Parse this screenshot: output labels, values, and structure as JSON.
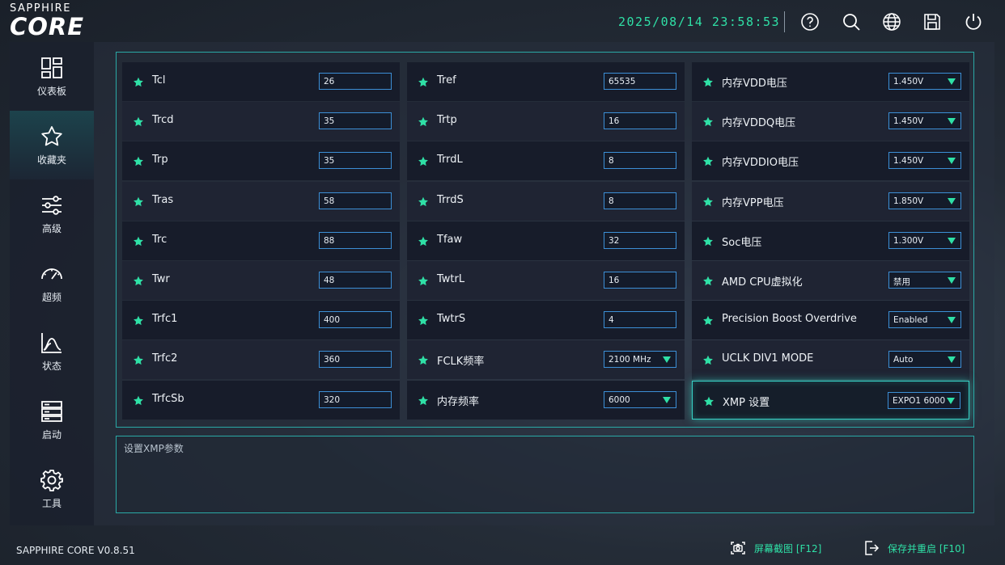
{
  "header": {
    "brand_small": "SAPPHIRE",
    "brand_big": "CORE",
    "datetime": "2025/08/14 23:58:53"
  },
  "sidebar": {
    "items": [
      {
        "label": "仪表板",
        "icon": "dashboard-icon"
      },
      {
        "label": "收藏夹",
        "icon": "star-icon"
      },
      {
        "label": "高级",
        "icon": "sliders-icon"
      },
      {
        "label": "超频",
        "icon": "gauge-icon"
      },
      {
        "label": "状态",
        "icon": "chart-icon"
      },
      {
        "label": "启动",
        "icon": "server-icon"
      },
      {
        "label": "工具",
        "icon": "gear-icon"
      }
    ],
    "active_index": 1
  },
  "settings": {
    "col1": [
      {
        "label": "Tcl",
        "value": "26"
      },
      {
        "label": "Trcd",
        "value": "35"
      },
      {
        "label": "Trp",
        "value": "35"
      },
      {
        "label": "Tras",
        "value": "58"
      },
      {
        "label": "Trc",
        "value": "88"
      },
      {
        "label": "Twr",
        "value": "48"
      },
      {
        "label": "Trfc1",
        "value": "400"
      },
      {
        "label": "Trfc2",
        "value": "360"
      },
      {
        "label": "TrfcSb",
        "value": "320"
      }
    ],
    "col2": [
      {
        "label": "Tref",
        "value": "65535"
      },
      {
        "label": "Trtp",
        "value": "16"
      },
      {
        "label": "TrrdL",
        "value": "8"
      },
      {
        "label": "TrrdS",
        "value": "8"
      },
      {
        "label": "Tfaw",
        "value": "32"
      },
      {
        "label": "TwtrL",
        "value": "16"
      },
      {
        "label": "TwtrS",
        "value": "4"
      },
      {
        "label": "FCLK频率",
        "value": "2100 MHz"
      },
      {
        "label": "内存频率",
        "value": "6000"
      }
    ],
    "col3": [
      {
        "label": "内存VDD电压",
        "value": "1.450V"
      },
      {
        "label": "内存VDDQ电压",
        "value": "1.450V"
      },
      {
        "label": "内存VDDIO电压",
        "value": "1.450V"
      },
      {
        "label": "内存VPP电压",
        "value": "1.850V"
      },
      {
        "label": "Soc电压",
        "value": "1.300V"
      },
      {
        "label": "AMD CPU虚拟化",
        "value": "禁用"
      },
      {
        "label": "Precision Boost Overdrive",
        "value": "Enabled"
      },
      {
        "label": "UCLK DIV1 MODE",
        "value": "Auto"
      },
      {
        "label": "XMP 设置",
        "value": "EXPO1 6000"
      }
    ]
  },
  "description": "设置XMP参数",
  "footer": {
    "version": "SAPPHIRE CORE V0.8.51",
    "screenshot_label": "屏幕截图 [F12]",
    "save_label": "保存并重启 [F10]"
  },
  "colors": {
    "accent": "#2fe0a6",
    "frame": "#2aa9a6",
    "field_border": "#3c8fd6"
  }
}
